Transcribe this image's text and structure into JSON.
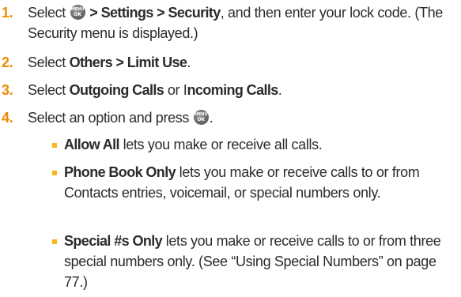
{
  "steps": [
    {
      "number": "1.",
      "pre": "Select ",
      "bold_path": "> Settings > Security",
      "rest": ", and then enter your lock code. (The Security menu is displayed.)"
    },
    {
      "number": "2.",
      "pre": "Select ",
      "bold": "Others > Limit Use",
      "post": "."
    },
    {
      "number": "3.",
      "pre": "Select ",
      "bold1": "Outgoing Calls",
      "mid": " or I",
      "bold2": "ncoming Calls",
      "post": "."
    },
    {
      "number": "4.",
      "text": "Select an option and press ",
      "post": "."
    }
  ],
  "options": [
    {
      "name": "Allow All",
      "desc": " lets you make or receive all calls."
    },
    {
      "name": "Phone Book Only",
      "desc": " lets you make or receive calls to or from Contacts entries, voicemail, or special numbers only."
    },
    {
      "name": "Special #s Only",
      "desc": " lets you make or receive calls to or from three special numbers only. (See “Using Special Numbers” on page 77.)"
    }
  ],
  "menu_key": {
    "icon": "menu-ok-key-icon",
    "line1": "MENU",
    "line2": "OK"
  },
  "colors": {
    "step_number": "#ed8b00",
    "bullet": "#f5b71a",
    "text": "#2b2b2b"
  }
}
